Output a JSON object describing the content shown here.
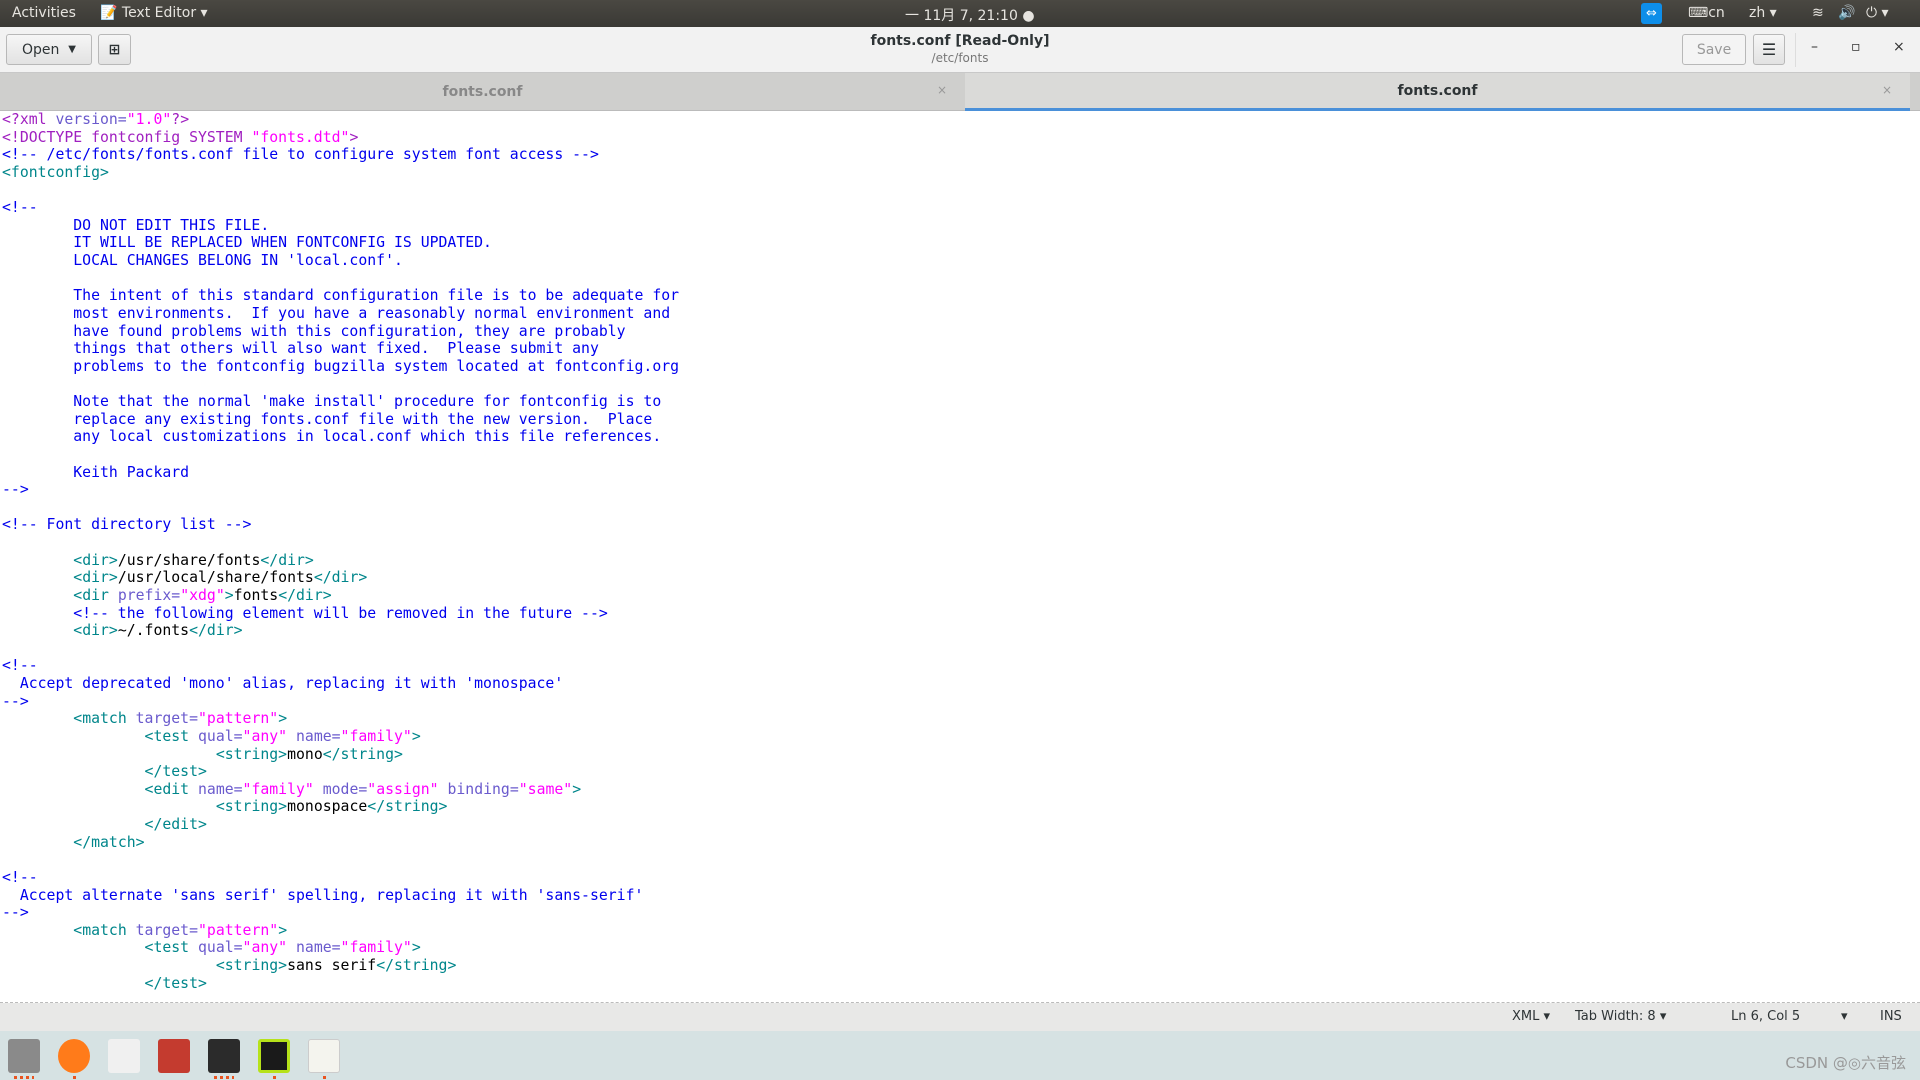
{
  "topbar": {
    "activities": "Activities",
    "app_menu": "Text Editor",
    "clock": "一 11月 7, 21:10",
    "input_method": "cn",
    "language": "zh"
  },
  "header": {
    "open_label": "Open",
    "title": "fonts.conf [Read-Only]",
    "subtitle": "/etc/fonts",
    "save_label": "Save"
  },
  "tabs": [
    {
      "label": "fonts.conf",
      "active": false
    },
    {
      "label": "fonts.conf",
      "active": true
    }
  ],
  "colors": {
    "accent": "#4a90d9",
    "tag": "#00868b",
    "attribute": "#6a5acd",
    "string": "#ff00ff",
    "comment": "#0000ee"
  },
  "code": [
    [
      [
        "p",
        "<?xml "
      ],
      [
        "a",
        "version="
      ],
      [
        "s",
        "\"1.0\""
      ],
      [
        "p",
        "?>"
      ]
    ],
    [
      [
        "p",
        "<!DOCTYPE fontconfig SYSTEM "
      ],
      [
        "s",
        "\"fonts.dtd\""
      ],
      [
        "p",
        ">"
      ]
    ],
    [
      [
        "c",
        "<!-- /etc/fonts/fonts.conf file to configure system font access -->"
      ]
    ],
    [
      [
        "t",
        "<fontconfig>"
      ]
    ],
    [],
    [
      [
        "c",
        "<!--"
      ]
    ],
    [
      [
        "c",
        "        DO NOT EDIT THIS FILE."
      ]
    ],
    [
      [
        "c",
        "        IT WILL BE REPLACED WHEN FONTCONFIG IS UPDATED."
      ]
    ],
    [
      [
        "c",
        "        LOCAL CHANGES BELONG IN 'local.conf'."
      ]
    ],
    [],
    [
      [
        "c",
        "        The intent of this standard configuration file is to be adequate for"
      ]
    ],
    [
      [
        "c",
        "        most environments.  If you have a reasonably normal environment and"
      ]
    ],
    [
      [
        "c",
        "        have found problems with this configuration, they are probably"
      ]
    ],
    [
      [
        "c",
        "        things that others will also want fixed.  Please submit any"
      ]
    ],
    [
      [
        "c",
        "        problems to the fontconfig bugzilla system located at fontconfig.org"
      ]
    ],
    [],
    [
      [
        "c",
        "        Note that the normal 'make install' procedure for fontconfig is to"
      ]
    ],
    [
      [
        "c",
        "        replace any existing fonts.conf file with the new version.  Place"
      ]
    ],
    [
      [
        "c",
        "        any local customizations in local.conf which this file references."
      ]
    ],
    [],
    [
      [
        "c",
        "        Keith Packard"
      ]
    ],
    [
      [
        "c",
        "-->"
      ]
    ],
    [],
    [
      [
        "c",
        "<!-- Font directory list -->"
      ]
    ],
    [],
    [
      [
        "x",
        "        "
      ],
      [
        "t",
        "<dir>"
      ],
      [
        "x",
        "/usr/share/fonts"
      ],
      [
        "t",
        "</dir>"
      ]
    ],
    [
      [
        "x",
        "        "
      ],
      [
        "t",
        "<dir>"
      ],
      [
        "x",
        "/usr/local/share/fonts"
      ],
      [
        "t",
        "</dir>"
      ]
    ],
    [
      [
        "x",
        "        "
      ],
      [
        "t",
        "<dir "
      ],
      [
        "a",
        "prefix="
      ],
      [
        "s",
        "\"xdg\""
      ],
      [
        "t",
        ">"
      ],
      [
        "x",
        "fonts"
      ],
      [
        "t",
        "</dir>"
      ]
    ],
    [
      [
        "c",
        "        <!-- the following element will be removed in the future -->"
      ]
    ],
    [
      [
        "x",
        "        "
      ],
      [
        "t",
        "<dir>"
      ],
      [
        "x",
        "~/.fonts"
      ],
      [
        "t",
        "</dir>"
      ]
    ],
    [],
    [
      [
        "c",
        "<!--"
      ]
    ],
    [
      [
        "c",
        "  Accept deprecated 'mono' alias, replacing it with 'monospace'"
      ]
    ],
    [
      [
        "c",
        "-->"
      ]
    ],
    [
      [
        "x",
        "        "
      ],
      [
        "t",
        "<match "
      ],
      [
        "a",
        "target="
      ],
      [
        "s",
        "\"pattern\""
      ],
      [
        "t",
        ">"
      ]
    ],
    [
      [
        "x",
        "                "
      ],
      [
        "t",
        "<test "
      ],
      [
        "a",
        "qual="
      ],
      [
        "s",
        "\"any\""
      ],
      [
        "a",
        " name="
      ],
      [
        "s",
        "\"family\""
      ],
      [
        "t",
        ">"
      ]
    ],
    [
      [
        "x",
        "                        "
      ],
      [
        "t",
        "<string>"
      ],
      [
        "x",
        "mono"
      ],
      [
        "t",
        "</string>"
      ]
    ],
    [
      [
        "x",
        "                "
      ],
      [
        "t",
        "</test>"
      ]
    ],
    [
      [
        "x",
        "                "
      ],
      [
        "t",
        "<edit "
      ],
      [
        "a",
        "name="
      ],
      [
        "s",
        "\"family\""
      ],
      [
        "a",
        " mode="
      ],
      [
        "s",
        "\"assign\""
      ],
      [
        "a",
        " binding="
      ],
      [
        "s",
        "\"same\""
      ],
      [
        "t",
        ">"
      ]
    ],
    [
      [
        "x",
        "                        "
      ],
      [
        "t",
        "<string>"
      ],
      [
        "x",
        "monospace"
      ],
      [
        "t",
        "</string>"
      ]
    ],
    [
      [
        "x",
        "                "
      ],
      [
        "t",
        "</edit>"
      ]
    ],
    [
      [
        "x",
        "        "
      ],
      [
        "t",
        "</match>"
      ]
    ],
    [],
    [
      [
        "c",
        "<!--"
      ]
    ],
    [
      [
        "c",
        "  Accept alternate 'sans serif' spelling, replacing it with 'sans-serif'"
      ]
    ],
    [
      [
        "c",
        "-->"
      ]
    ],
    [
      [
        "x",
        "        "
      ],
      [
        "t",
        "<match "
      ],
      [
        "a",
        "target="
      ],
      [
        "s",
        "\"pattern\""
      ],
      [
        "t",
        ">"
      ]
    ],
    [
      [
        "x",
        "                "
      ],
      [
        "t",
        "<test "
      ],
      [
        "a",
        "qual="
      ],
      [
        "s",
        "\"any\""
      ],
      [
        "a",
        " name="
      ],
      [
        "s",
        "\"family\""
      ],
      [
        "t",
        ">"
      ]
    ],
    [
      [
        "x",
        "                        "
      ],
      [
        "t",
        "<string>"
      ],
      [
        "x",
        "sans serif"
      ],
      [
        "t",
        "</string>"
      ]
    ],
    [
      [
        "x",
        "                "
      ],
      [
        "t",
        "</test>"
      ]
    ]
  ],
  "status": {
    "language": "XML",
    "tab_width": "Tab Width: 8",
    "position": "Ln 6, Col 5",
    "mode": "INS"
  },
  "dock": [
    "files",
    "firefox",
    "software-center",
    "system-tools",
    "terminal",
    "pycharm",
    "text-editor"
  ],
  "watermark": "CSDN @◎六音弦"
}
